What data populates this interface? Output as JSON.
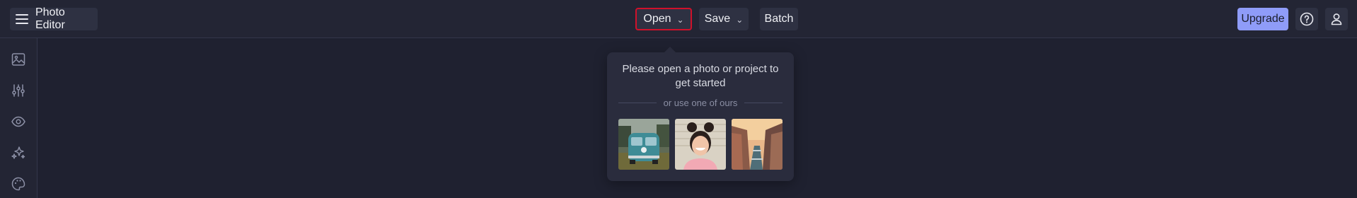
{
  "header": {
    "menu_icon": "hamburger-menu-icon",
    "app_title": "Photo Editor",
    "open_label": "Open",
    "save_label": "Save",
    "batch_label": "Batch",
    "upgrade_label": "Upgrade",
    "help_icon": "question-circle-icon",
    "user_icon": "user-icon"
  },
  "sidebar": {
    "items": [
      {
        "icon": "image-icon"
      },
      {
        "icon": "adjustments-sliders-icon"
      },
      {
        "icon": "eye-icon"
      },
      {
        "icon": "sparkles-effects-icon"
      },
      {
        "icon": "palette-icon"
      }
    ]
  },
  "open_popup": {
    "message": "Please open a photo or project to get started",
    "separator_text": "or use one of ours",
    "samples": [
      {
        "name": "sample-photo-vw-van"
      },
      {
        "name": "sample-photo-smiling-woman"
      },
      {
        "name": "sample-photo-canal-city"
      }
    ]
  },
  "colors": {
    "background": "#1f2130",
    "bar": "#232534",
    "accent": "#8f9cf8",
    "highlight": "#d0112b"
  }
}
